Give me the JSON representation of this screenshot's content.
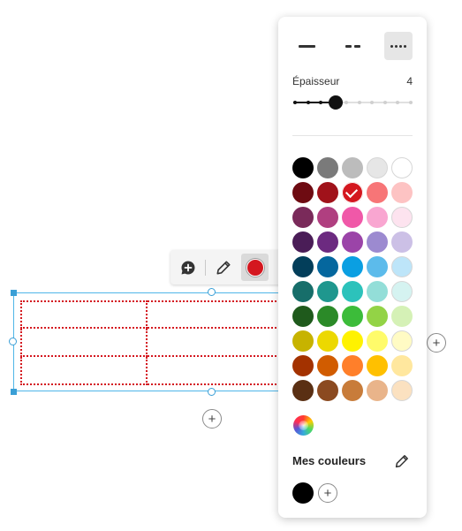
{
  "toolbar": {
    "items": [
      {
        "name": "comment-icon"
      },
      {
        "name": "pen-icon"
      },
      {
        "name": "border-color-button",
        "color": "#d4171f"
      }
    ]
  },
  "table_widget": {
    "rows": 3,
    "cols": 2,
    "border_color": "#d4171f",
    "selection_color": "#4fb6e8",
    "add_symbol": "+"
  },
  "panel": {
    "line_styles": [
      {
        "name": "solid",
        "selected": false
      },
      {
        "name": "dashed",
        "selected": false
      },
      {
        "name": "dotted",
        "selected": true
      }
    ],
    "thickness": {
      "label": "Épaisseur",
      "value": "4",
      "min": 1,
      "max": 10
    },
    "palette": [
      [
        "#000000",
        "#7a7a7a",
        "#bcbcbc",
        "#e6e6e6",
        "#ffffff"
      ],
      [
        "#6e0b12",
        "#a0121a",
        "#d4171f",
        "#f77577",
        "#fdc3c3"
      ],
      [
        "#7a2a5a",
        "#b03f80",
        "#f058a8",
        "#f9a6d1",
        "#fde3ef"
      ],
      [
        "#4a1d57",
        "#6c2a80",
        "#9b44a8",
        "#9c8ad0",
        "#ccc0e6"
      ],
      [
        "#033e5a",
        "#05679e",
        "#0a9fe2",
        "#5cbbeb",
        "#bde5f9"
      ],
      [
        "#176e6a",
        "#1f978e",
        "#2cc2bb",
        "#93ded8",
        "#d5f3f1"
      ],
      [
        "#1f5a1c",
        "#2b8a28",
        "#3cbc3a",
        "#93d346",
        "#d5f1b6"
      ],
      [
        "#c7b300",
        "#ecd800",
        "#fff200",
        "#fffb6a",
        "#fffbc4"
      ],
      [
        "#a33200",
        "#d15c00",
        "#ff7f2a",
        "#ffc000",
        "#ffe79e"
      ],
      [
        "#5a2f13",
        "#8b4a20",
        "#c87c3a",
        "#e9b48a",
        "#fbe1c0"
      ]
    ],
    "selected_swatch": "#d4171f",
    "my_colors_title": "Mes couleurs",
    "my_colors": [
      "#000000"
    ],
    "add_symbol": "+"
  }
}
